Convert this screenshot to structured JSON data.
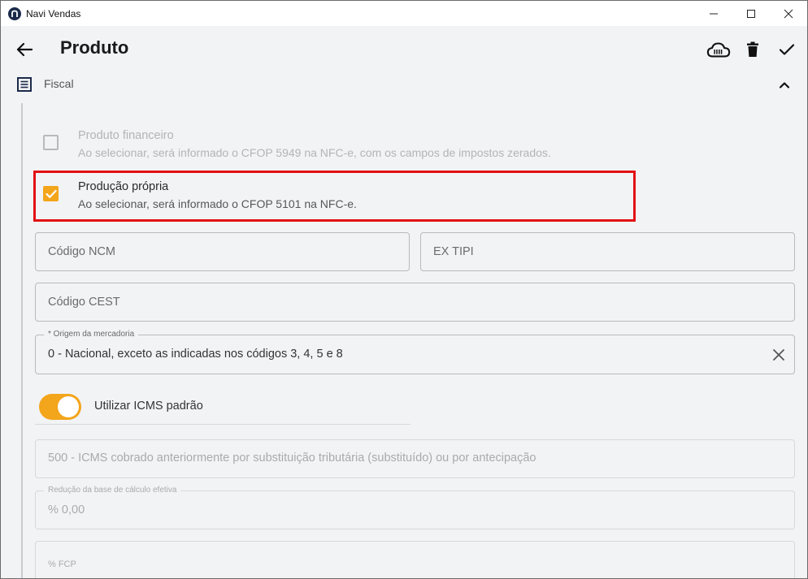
{
  "window": {
    "title": "Navi Vendas"
  },
  "appbar": {
    "title": "Produto"
  },
  "section": {
    "title": "Fiscal"
  },
  "checks": {
    "financeiro": {
      "label": "Produto financeiro",
      "desc": "Ao selecionar, será informado o CFOP 5949 na NFC-e, com os campos de impostos zerados."
    },
    "propria": {
      "label": "Produção própria",
      "desc": "Ao selecionar, será informado o CFOP 5101 na NFC-e."
    }
  },
  "fields": {
    "ncm_placeholder": "Código NCM",
    "extipi_placeholder": "EX TIPI",
    "cest_placeholder": "Código CEST",
    "origem_label": "* Origem da mercadoria",
    "origem_value": "0 - Nacional, exceto as indicadas nos códigos 3, 4, 5 e 8",
    "icms_value": "500 - ICMS cobrado anteriormente por substituição tributária (substituído) ou por antecipação",
    "reducao_label": "Redução da base de cálculo efetiva",
    "reducao_value": "% 0,00",
    "partial_value": "% FCP"
  },
  "toggle": {
    "label": "Utilizar ICMS padrão"
  },
  "colors": {
    "accent": "#f3a51b",
    "highlight": "#e20f13"
  }
}
